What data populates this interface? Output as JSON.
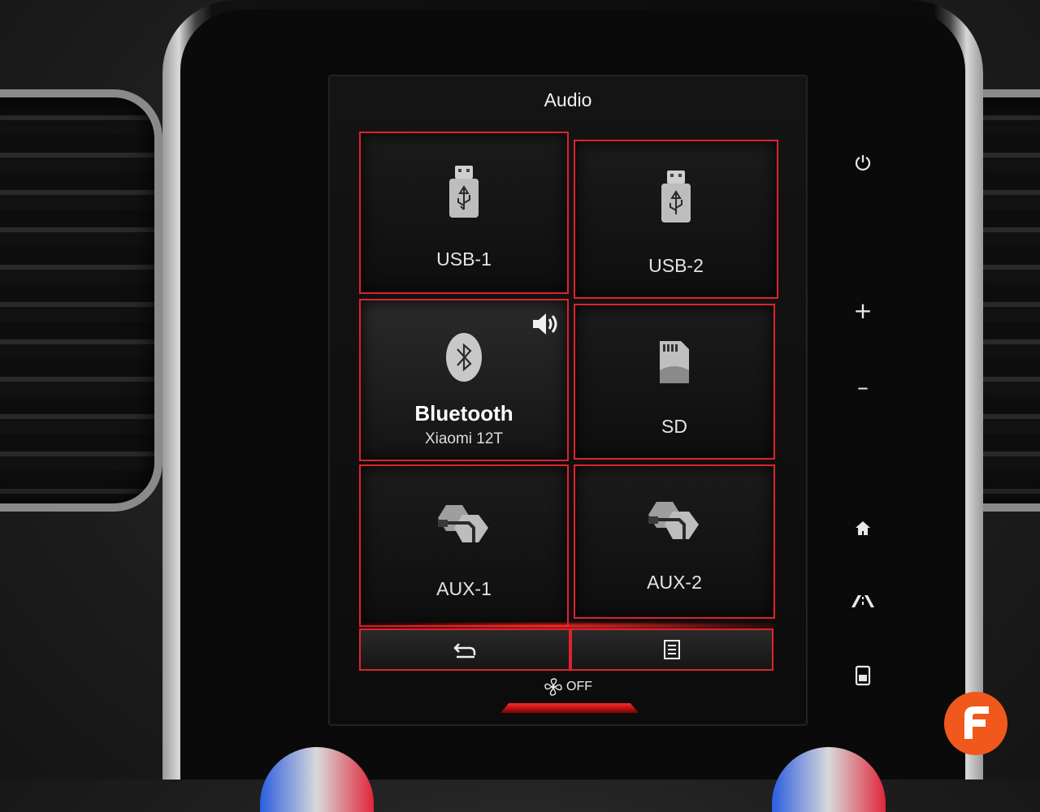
{
  "screen": {
    "title": "Audio",
    "tiles": [
      {
        "id": "usb1",
        "label": "USB-1",
        "icon": "usb-drive-icon"
      },
      {
        "id": "usb2",
        "label": "USB-2",
        "icon": "usb-drive-icon"
      },
      {
        "id": "bluetooth",
        "label": "Bluetooth",
        "sublabel": "Xiaomi 12T",
        "icon": "bluetooth-icon",
        "active": true,
        "status_icon": "speaker-icon"
      },
      {
        "id": "sd",
        "label": "SD",
        "icon": "sd-card-icon"
      },
      {
        "id": "aux1",
        "label": "AUX-1",
        "icon": "aux-cable-icon"
      },
      {
        "id": "aux2",
        "label": "AUX-2",
        "icon": "aux-cable-icon"
      }
    ],
    "bottom_bar": {
      "back_icon": "back-arrow-icon",
      "menu_icon": "list-menu-icon"
    },
    "climate": {
      "fan_icon": "fan-icon",
      "fan_status": "OFF"
    }
  },
  "hardware_buttons": {
    "power_icon": "power-icon",
    "volume_up": "+",
    "volume_down": "–",
    "home_icon": "home-icon",
    "navigation_icon": "road-icon",
    "phone_icon": "phone-icon"
  },
  "colors": {
    "accent": "#e0222d",
    "brand": "#f0581c"
  }
}
